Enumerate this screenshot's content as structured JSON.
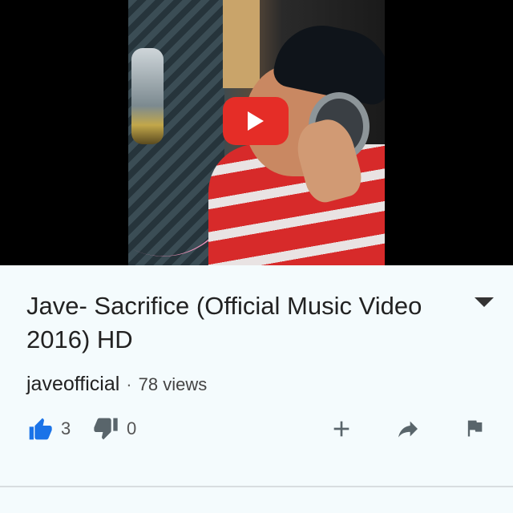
{
  "video": {
    "title": "Jave- Sacrifice (Official Music Video 2016) HD",
    "channel": "javeofficial",
    "separator": "·",
    "views": "78 views"
  },
  "actions": {
    "likes": "3",
    "dislikes": "0"
  },
  "icons": {
    "play": "play-icon",
    "expand": "chevron-down-icon",
    "like": "thumbs-up-icon",
    "dislike": "thumbs-down-icon",
    "add": "plus-icon",
    "share": "share-icon",
    "report": "flag-icon"
  },
  "colors": {
    "accent_blue": "#1a73e8",
    "play_red": "#e52d27",
    "icon_gray": "#59656b"
  }
}
